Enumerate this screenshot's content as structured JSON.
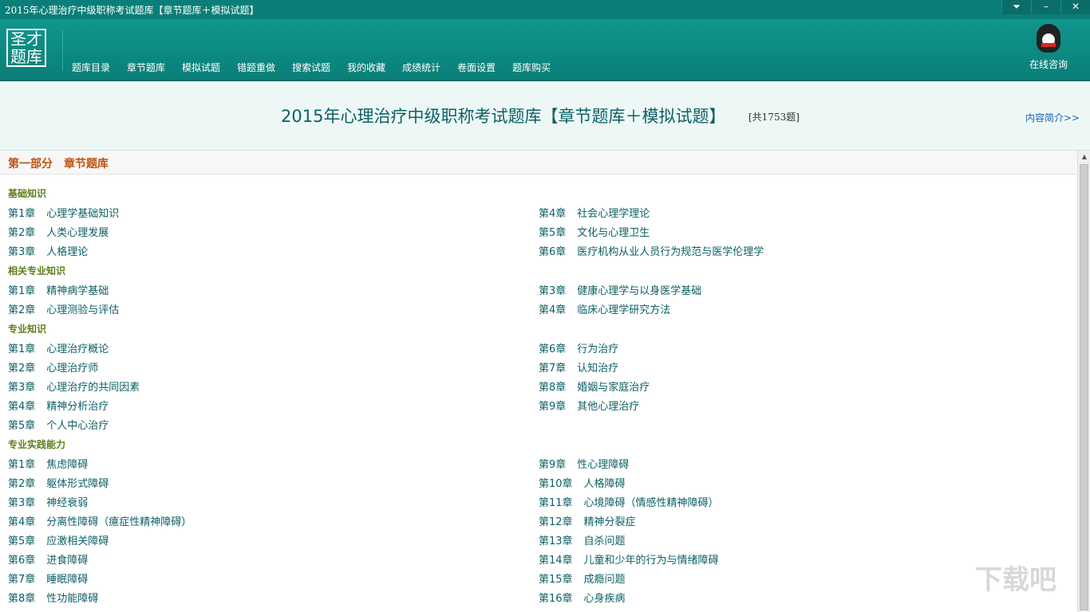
{
  "window": {
    "title": "2015年心理治疗中级职称考试题库【章节题库＋模拟试题】",
    "menu_icon": "menu-icon",
    "minimize": "–",
    "close": "✕"
  },
  "logo": {
    "line1": "圣才",
    "line2": "题库"
  },
  "nav": [
    "题库目录",
    "章节题库",
    "模拟试题",
    "错题重做",
    "搜索试题",
    "我的收藏",
    "成绩统计",
    "卷面设置",
    "题库购买"
  ],
  "consult": {
    "label": "在线咨询",
    "icon": "qq-penguin-icon"
  },
  "header": {
    "title": "2015年心理治疗中级职称考试题库【章节题库＋模拟试题】",
    "count": "[共1753题]",
    "intro": "内容简介>>"
  },
  "section": "第一部分　章节题库",
  "categories": [
    {
      "name": "基础知识",
      "left": [
        [
          "第1章",
          "心理学基础知识"
        ],
        [
          "第2章",
          "人类心理发展"
        ],
        [
          "第3章",
          "人格理论"
        ]
      ],
      "right": [
        [
          "第4章",
          "社会心理学理论"
        ],
        [
          "第5章",
          "文化与心理卫生"
        ],
        [
          "第6章",
          "医疗机构从业人员行为规范与医学伦理学"
        ]
      ]
    },
    {
      "name": "相关专业知识",
      "left": [
        [
          "第1章",
          "精神病学基础"
        ],
        [
          "第2章",
          "心理测验与评估"
        ]
      ],
      "right": [
        [
          "第3章",
          "健康心理学与以身医学基础"
        ],
        [
          "第4章",
          "临床心理学研究方法"
        ]
      ]
    },
    {
      "name": "专业知识",
      "left": [
        [
          "第1章",
          "心理治疗概论"
        ],
        [
          "第2章",
          "心理治疗师"
        ],
        [
          "第3章",
          "心理治疗的共同因素"
        ],
        [
          "第4章",
          "精神分析治疗"
        ],
        [
          "第5章",
          "个人中心治疗"
        ]
      ],
      "right": [
        [
          "第6章",
          "行为治疗"
        ],
        [
          "第7章",
          "认知治疗"
        ],
        [
          "第8章",
          "婚姻与家庭治疗"
        ],
        [
          "第9章",
          "其他心理治疗"
        ]
      ]
    },
    {
      "name": "专业实践能力",
      "left": [
        [
          "第1章",
          "焦虑障碍"
        ],
        [
          "第2章",
          "躯体形式障碍"
        ],
        [
          "第3章",
          "神经衰弱"
        ],
        [
          "第4章",
          "分离性障碍（癔症性精神障碍）"
        ],
        [
          "第5章",
          "应激相关障碍"
        ],
        [
          "第6章",
          "进食障碍"
        ],
        [
          "第7章",
          "睡眠障碍"
        ],
        [
          "第8章",
          "性功能障碍"
        ]
      ],
      "right": [
        [
          "第9章",
          "性心理障碍"
        ],
        [
          "第10章",
          "人格障碍"
        ],
        [
          "第11章",
          "心境障碍（情感性精神障碍）"
        ],
        [
          "第12章",
          "精神分裂症"
        ],
        [
          "第13章",
          "自杀问题"
        ],
        [
          "第14章",
          "儿童和少年的行为与情绪障碍"
        ],
        [
          "第15章",
          "成瘾问题"
        ],
        [
          "第16章",
          "心身疾病"
        ]
      ]
    }
  ],
  "watermark": "下载吧"
}
